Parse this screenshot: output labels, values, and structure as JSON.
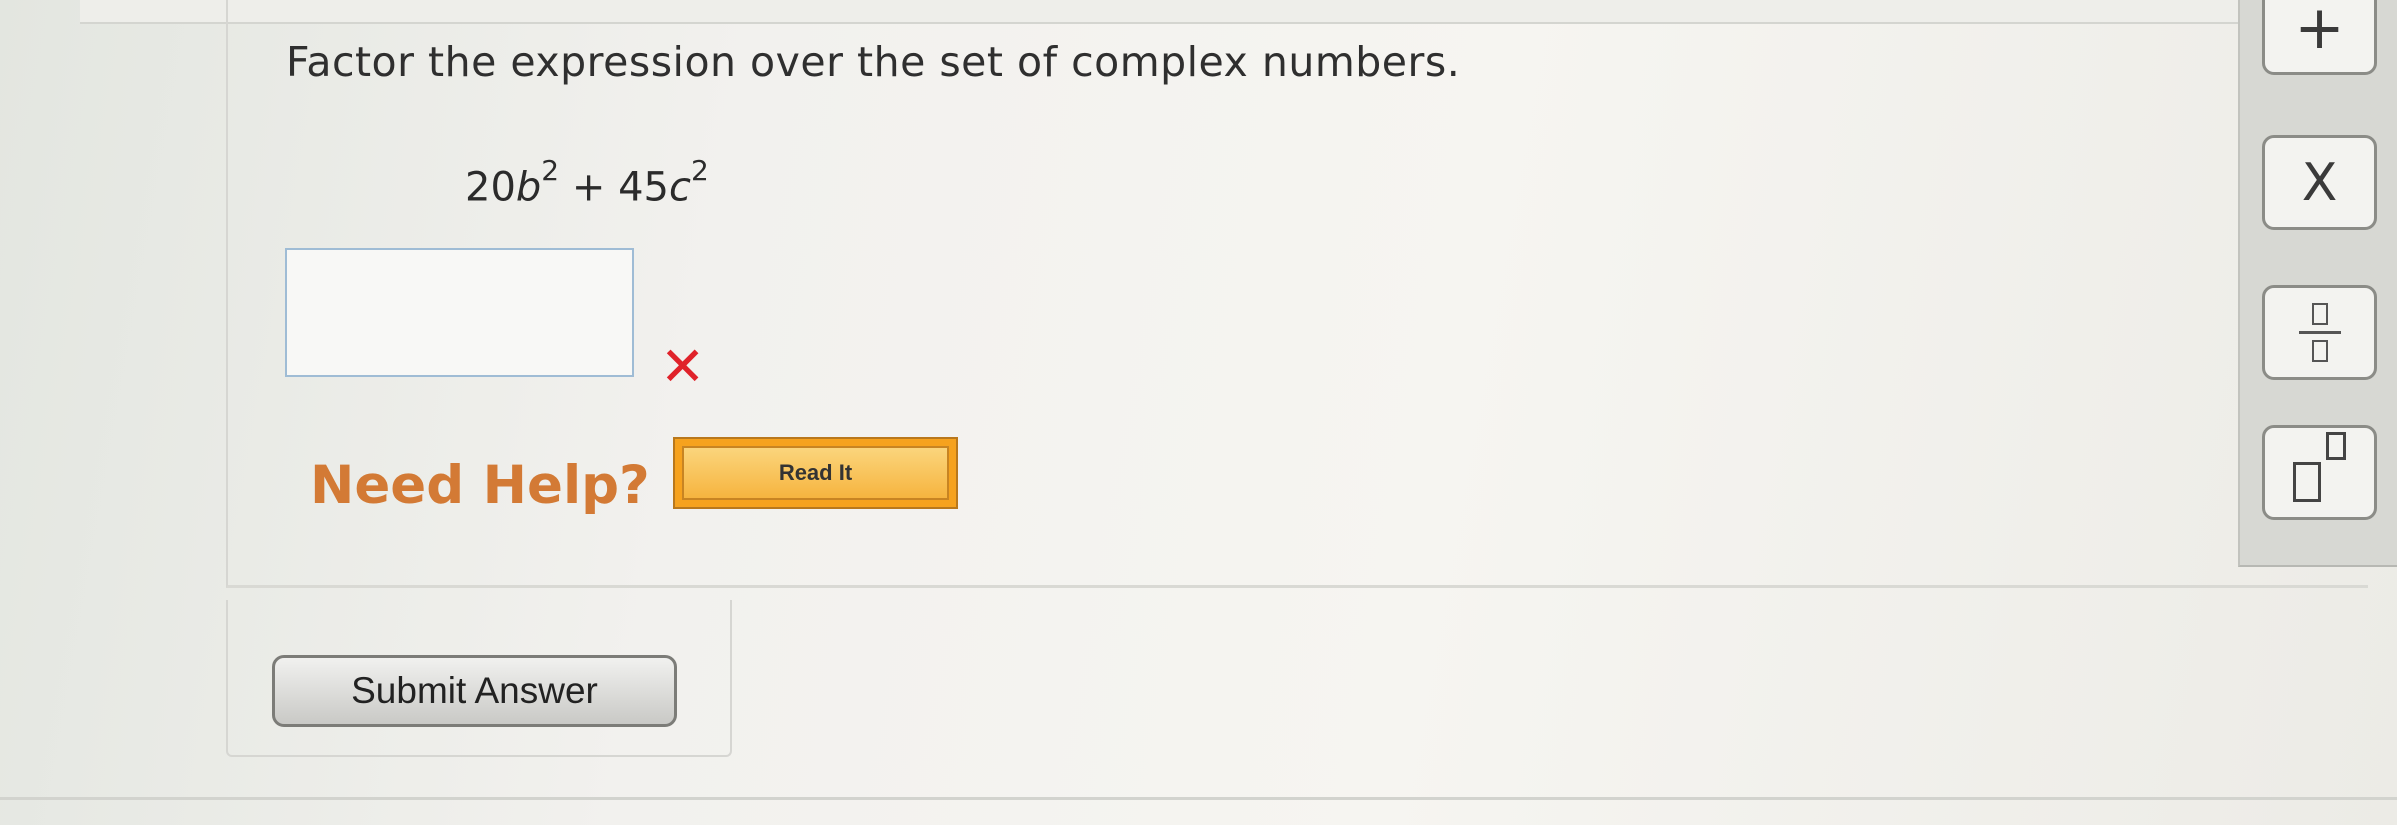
{
  "question": {
    "prompt": "Factor the expression over the set of complex numbers.",
    "expression": {
      "term1_coef": "20",
      "term1_var": "b",
      "term1_exp": "2",
      "operator": "+",
      "term2_coef": "45",
      "term2_var": "c",
      "term2_exp": "2"
    },
    "answer_value": "",
    "status_mark": "✕",
    "status_color": "#e0222a"
  },
  "help": {
    "label": "Need Help?",
    "read_it_label": "Read It",
    "accent": "#f6a21e"
  },
  "submit": {
    "label": "Submit Answer"
  },
  "math_toolbar": {
    "plus": "+",
    "times": "X",
    "fraction_icon": "fraction-template-icon",
    "power_icon": "exponent-template-icon"
  }
}
